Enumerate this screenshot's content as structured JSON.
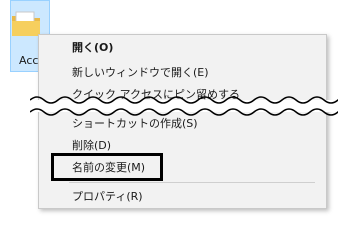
{
  "desktop": {
    "folder_label": "Acc"
  },
  "context_menu": {
    "items": [
      {
        "label": "開く(O)",
        "default": true
      },
      {
        "label": "新しいウィンドウで開く(E)"
      },
      {
        "label": "クイック アクセスにピン留めする"
      },
      {
        "label": "ショートカットの作成(S)"
      },
      {
        "label": "削除(D)"
      },
      {
        "label": "名前の変更(M)",
        "highlighted": true
      },
      {
        "label": "プロパティ(R)"
      }
    ]
  },
  "colors": {
    "menu_background": "#f2f2f2",
    "selection_background": "#cce8ff",
    "highlight_border": "#000000"
  }
}
